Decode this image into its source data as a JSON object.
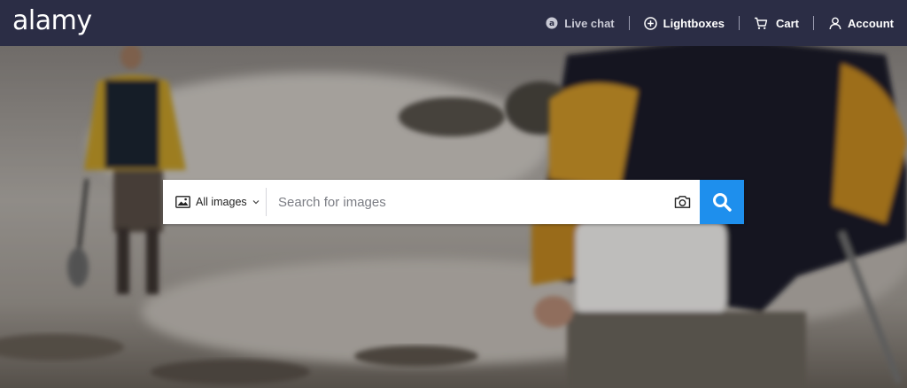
{
  "header": {
    "logo": "alamy",
    "nav": [
      {
        "label": "Live chat",
        "icon": "chat-icon"
      },
      {
        "label": "Lightboxes",
        "icon": "plus-circle-icon"
      },
      {
        "label": "Cart",
        "icon": "cart-icon"
      },
      {
        "label": "Account",
        "icon": "user-icon"
      }
    ]
  },
  "search": {
    "filter_label": "All images",
    "filter_icon": "image-icon",
    "placeholder": "Search for images",
    "visual_search_icon": "camera-icon",
    "submit_icon": "search-icon",
    "submit_color": "#1e8fed"
  },
  "colors": {
    "header_bg": "#2b2d45",
    "accent": "#1e8fed"
  }
}
